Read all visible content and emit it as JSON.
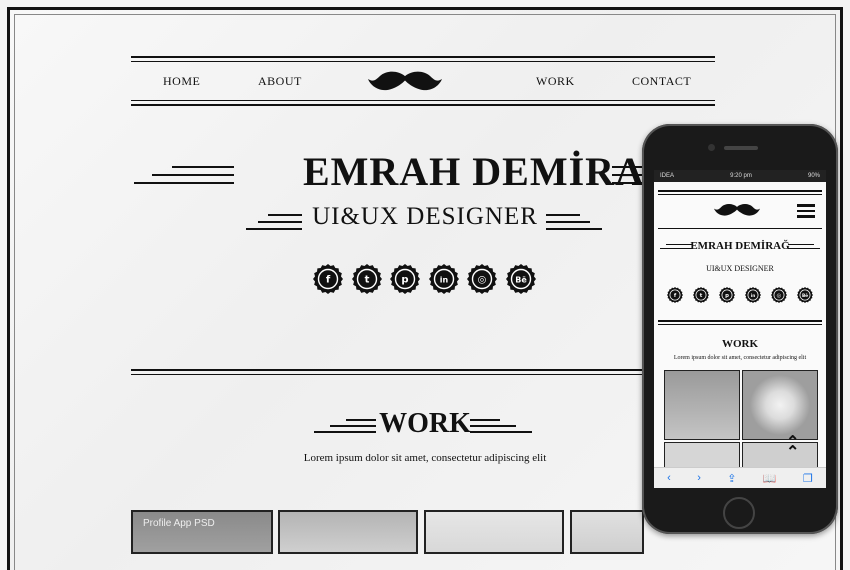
{
  "nav": {
    "items_left": [
      "HOME",
      "ABOUT"
    ],
    "items_right": [
      "WORK",
      "CONTACT"
    ]
  },
  "hero": {
    "name": "EMRAH DEMİRAĞ",
    "role": "UI&UX DESIGNER"
  },
  "social": [
    "facebook-icon",
    "twitter-icon",
    "pinterest-icon",
    "linkedin-icon",
    "dribbble-icon",
    "behance-icon"
  ],
  "social_glyphs": [
    "f",
    "t",
    "p",
    "in",
    "◎",
    "Bē"
  ],
  "work": {
    "title": "WORK",
    "subtitle": "Lorem ipsum dolor sit amet, consectetur adipiscing elit"
  },
  "thumbs": [
    {
      "label": "Profile App PSD"
    },
    {
      "label": ""
    },
    {
      "label": ""
    },
    {
      "label": ""
    }
  ],
  "mobile": {
    "carrier": "IDEA",
    "time": "9:20 pm",
    "battery": "90%",
    "name": "EMRAH DEMİRAĞ",
    "role": "UI&UX DESIGNER",
    "work_title": "WORK",
    "work_subtitle": "Lorem ipsum dolor sit amet, consectetur adipiscing elit",
    "toolbar": [
      "‹",
      "›",
      "⇪",
      "📖",
      "❐"
    ]
  },
  "colors": {
    "ink": "#111111",
    "paper": "#f3f3f3",
    "safari_blue": "#1a73e8"
  }
}
